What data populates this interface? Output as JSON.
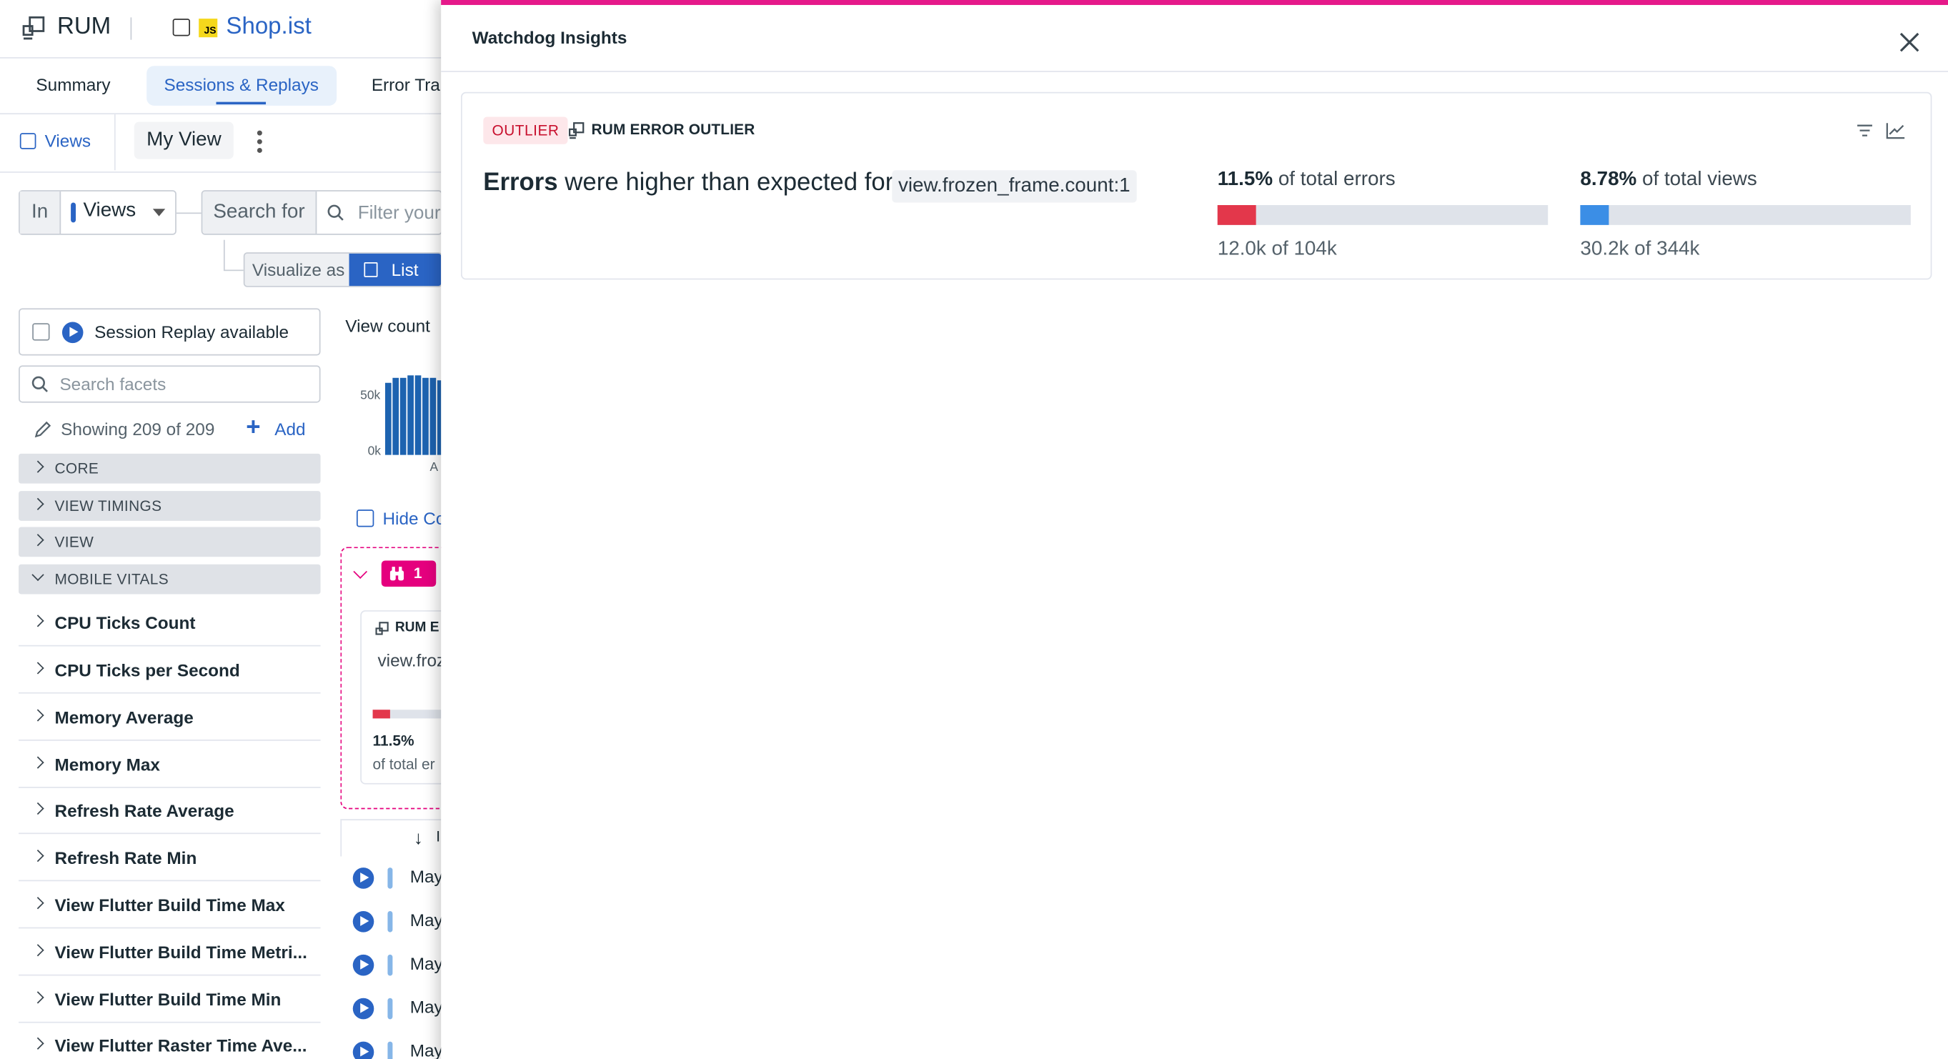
{
  "app": {
    "product": "RUM",
    "application_name": "Shop.ist",
    "application_badge": "JS"
  },
  "tabs": [
    {
      "label": "Summary",
      "active": false
    },
    {
      "label": "Sessions & Replays",
      "active": true
    },
    {
      "label": "Error Tra",
      "active": false
    }
  ],
  "views_bar": {
    "views_label": "Views",
    "current_view": "My View"
  },
  "query": {
    "in_label": "In",
    "in_value": "Views",
    "search_for_label": "Search for",
    "search_placeholder": "Filter your",
    "visualize_label": "Visualize as",
    "visualize_value": "List"
  },
  "facets": {
    "session_replay_label": "Session Replay available",
    "search_placeholder": "Search facets",
    "showing": "Showing 209 of 209",
    "add_label": "Add",
    "groups": [
      {
        "name": "CORE",
        "expanded": false
      },
      {
        "name": "VIEW TIMINGS",
        "expanded": false
      },
      {
        "name": "VIEW",
        "expanded": false
      },
      {
        "name": "MOBILE VITALS",
        "expanded": true
      }
    ],
    "items": [
      "CPU Ticks Count",
      "CPU Ticks per Second",
      "Memory Average",
      "Memory Max",
      "Refresh Rate Average",
      "Refresh Rate Min",
      "View Flutter Build Time Max",
      "View Flutter Build Time Metri...",
      "View Flutter Build Time Min",
      "View Flutter Raster Time Ave..."
    ]
  },
  "middle": {
    "view_count_label": "View count",
    "y_ticks": [
      "50k",
      "0k"
    ],
    "x_tick": "A",
    "hide_label": "Hide Co",
    "watchdog_count": "1",
    "mini_card_title": "RUM E",
    "mini_card_query": "view.froz",
    "mini_card_pct": "11.5%",
    "mini_card_sub": "of total er",
    "sort_col": "I",
    "rows": [
      "May",
      "May",
      "May",
      "May",
      "May"
    ]
  },
  "chart_data": {
    "type": "bar",
    "title": "View count",
    "series": [
      {
        "values": [
          48,
          52,
          52,
          53,
          53,
          52,
          52,
          50
        ]
      }
    ],
    "ylim": [
      0,
      55
    ],
    "y_ticks": [
      "0k",
      "50k"
    ],
    "note_unit": "k"
  },
  "panel": {
    "title": "Watchdog Insights",
    "badge": "OUTLIER",
    "card_type": "RUM ERROR OUTLIER",
    "headline_bold": "Errors",
    "headline_rest": " were higher than expected for",
    "query_chip": "view.frozen_frame.count:1",
    "stats": [
      {
        "pct": "11.5%",
        "of_label": " of total errors",
        "fraction": 0.115,
        "color": "#e3374b",
        "sub": "12.0k of 104k"
      },
      {
        "pct": "8.78%",
        "of_label": " of total views",
        "fraction": 0.0878,
        "color": "#3b8ee6",
        "sub": "30.2k of 344k"
      }
    ]
  },
  "colors": {
    "accent": "#2a64c4",
    "watchdog_pink": "#e5198a",
    "error_red": "#e3374b",
    "views_blue": "#3b8ee6"
  }
}
